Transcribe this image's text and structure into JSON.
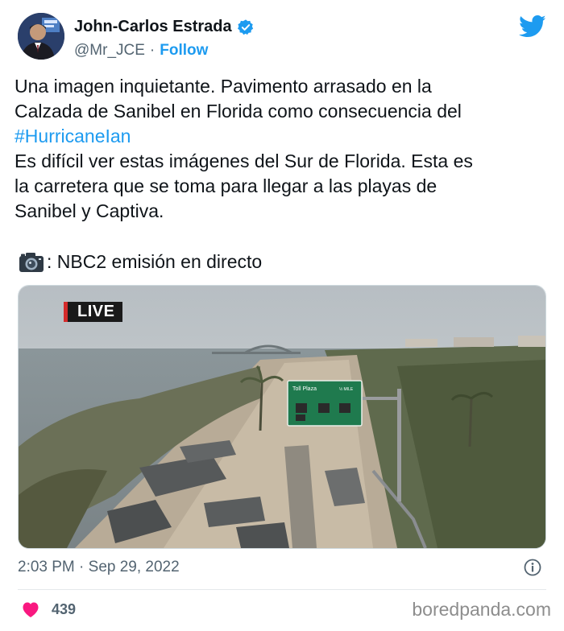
{
  "author": {
    "name": "John-Carlos Estrada",
    "handle": "@Mr_JCE",
    "follow_label": "Follow",
    "verified": true
  },
  "tweet": {
    "line1": "Una imagen inquietante. Pavimento arrasado en la",
    "line2": "Calzada de Sanibel en Florida como consecuencia del",
    "hashtag": "#HurricaneIan",
    "line3": "Es difícil ver estas imágenes del Sur de Florida. Esta es",
    "line4": "la carretera que se toma para llegar a las playas de",
    "line5": "Sanibel y Captiva.",
    "camera_caption": ": NBC2 emisión en directo"
  },
  "media": {
    "live_label": "LIVE",
    "sign_text": "Toll Plaza",
    "sign_text_small": "½ MILE"
  },
  "meta": {
    "timestamp": "2:03 PM · Sep 29, 2022",
    "likes": "439"
  },
  "watermark": "boredpanda.com",
  "colors": {
    "accent": "#1d9bf0",
    "like": "#f91880",
    "text": "#0f1419",
    "muted": "#536471"
  },
  "icons": [
    "verified-badge-icon",
    "twitter-bird-icon",
    "camera-icon",
    "info-icon",
    "heart-icon"
  ]
}
